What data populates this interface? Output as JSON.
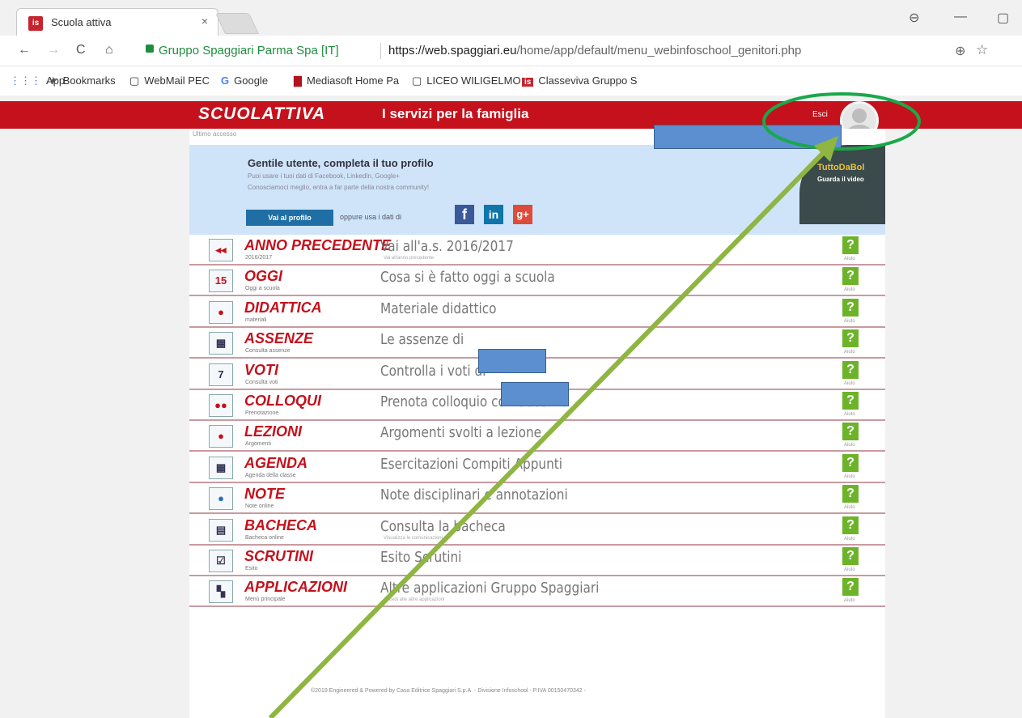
{
  "browser": {
    "tab_title": "Scuola attiva",
    "tab_close": "×",
    "site_name": "Gruppo Spaggiari Parma Spa [IT]",
    "url_host": "https://web.spaggiari.eu",
    "url_path": "/home/app/default/menu_webinfoschool_genitori.php",
    "bookmarks": [
      {
        "icon": "apps-grid-icon",
        "glyph": "⋮⋮⋮",
        "label": "App"
      },
      {
        "icon": "star-icon",
        "glyph": "★",
        "label": "Bookmarks"
      },
      {
        "icon": "page-icon",
        "glyph": "▢",
        "label": "WebMail PEC"
      },
      {
        "icon": "google-icon",
        "glyph": "G",
        "label": "Google"
      },
      {
        "icon": "mediasoft-icon",
        "glyph": "▇",
        "label": "Mediasoft Home Pa"
      },
      {
        "icon": "page-icon",
        "glyph": "▢",
        "label": "LICEO WILIGELMO"
      },
      {
        "icon": "classeviva-icon",
        "glyph": "is",
        "label": "Classeviva Gruppo S"
      }
    ]
  },
  "header": {
    "logo": "SCUOLATTIVA",
    "subtitle": "I servizi per la famiglia",
    "logout": "Esci"
  },
  "page": {
    "last_access": "Ultimo accesso",
    "profile": {
      "title": "Gentile utente, completa il tuo profilo",
      "line1": "Puoi usare i tuoi dati di Facebook, LinkedIn, Google+",
      "line2": "Conosciamoci meglio, entra a far parte della nostra community!",
      "button": "Vai al profilo",
      "or_text": "oppure usa i dati di",
      "video_brand": "TuttoDaBol",
      "video_label": "Guarda il video"
    },
    "menu": [
      {
        "name": "ANNO PRECEDENTE",
        "sub": "2016/2017",
        "desc": "Vai all'a.s. 2016/2017",
        "desc_sub": "Vai all'anno precedente",
        "icon": "calendar-back-icon",
        "glyph": "◂◂"
      },
      {
        "name": "OGGI",
        "sub": "Oggi a scuola",
        "desc": "Cosa si è fatto oggi a scuola",
        "desc_sub": "",
        "icon": "calendar-15-icon",
        "glyph": "15"
      },
      {
        "name": "DIDATTICA",
        "sub": "materiali",
        "desc": "Materiale didattico",
        "desc_sub": "",
        "icon": "blackboard-icon",
        "glyph": "●"
      },
      {
        "name": "ASSENZE",
        "sub": "Consulta assenze",
        "desc": "Le assenze di",
        "desc_sub": "",
        "icon": "absence-grid-icon",
        "glyph": "▦"
      },
      {
        "name": "VOTI",
        "sub": "Consulta voti",
        "desc": "Controlla i voti di",
        "desc_sub": "",
        "icon": "grade-7-icon",
        "glyph": "7"
      },
      {
        "name": "COLLOQUI",
        "sub": "Prenotazione",
        "desc": "Prenota colloquio con docente",
        "desc_sub": "",
        "icon": "meeting-icon",
        "glyph": "●●"
      },
      {
        "name": "LEZIONI",
        "sub": "Argomenti",
        "desc": "Argomenti svolti a lezione",
        "desc_sub": "",
        "icon": "teacher-icon",
        "glyph": "●"
      },
      {
        "name": "AGENDA",
        "sub": "Agenda della classe",
        "desc": "Esercitazioni Compiti Appunti",
        "desc_sub": "",
        "icon": "agenda-icon",
        "glyph": "▦"
      },
      {
        "name": "NOTE",
        "sub": "Note online",
        "desc": "Note disciplinari e annotazioni",
        "desc_sub": "",
        "icon": "note-icon",
        "glyph": "●"
      },
      {
        "name": "BACHECA",
        "sub": "Bacheca online",
        "desc": "Consulta la bacheca",
        "desc_sub": "Visualizza le comunicazioni",
        "icon": "board-icon",
        "glyph": "▤"
      },
      {
        "name": "SCRUTINI",
        "sub": "Esito",
        "desc": "Esito Scrutini",
        "desc_sub": "",
        "icon": "checklist-icon",
        "glyph": "☑"
      },
      {
        "name": "APPLICAZIONI",
        "sub": "Menù principale",
        "desc": "Altre applicazioni Gruppo Spaggiari",
        "desc_sub": "Accedi alle altre applicazioni",
        "icon": "apps-tiles-icon",
        "glyph": "▚"
      }
    ],
    "help_glyph": "?",
    "help_label": "Aiuto",
    "footer": "©2019 Engineered & Powered by Casa Editrice Spaggiari S.p.A. - Divisione Infoschool - P.IVA 00150470342 -"
  }
}
